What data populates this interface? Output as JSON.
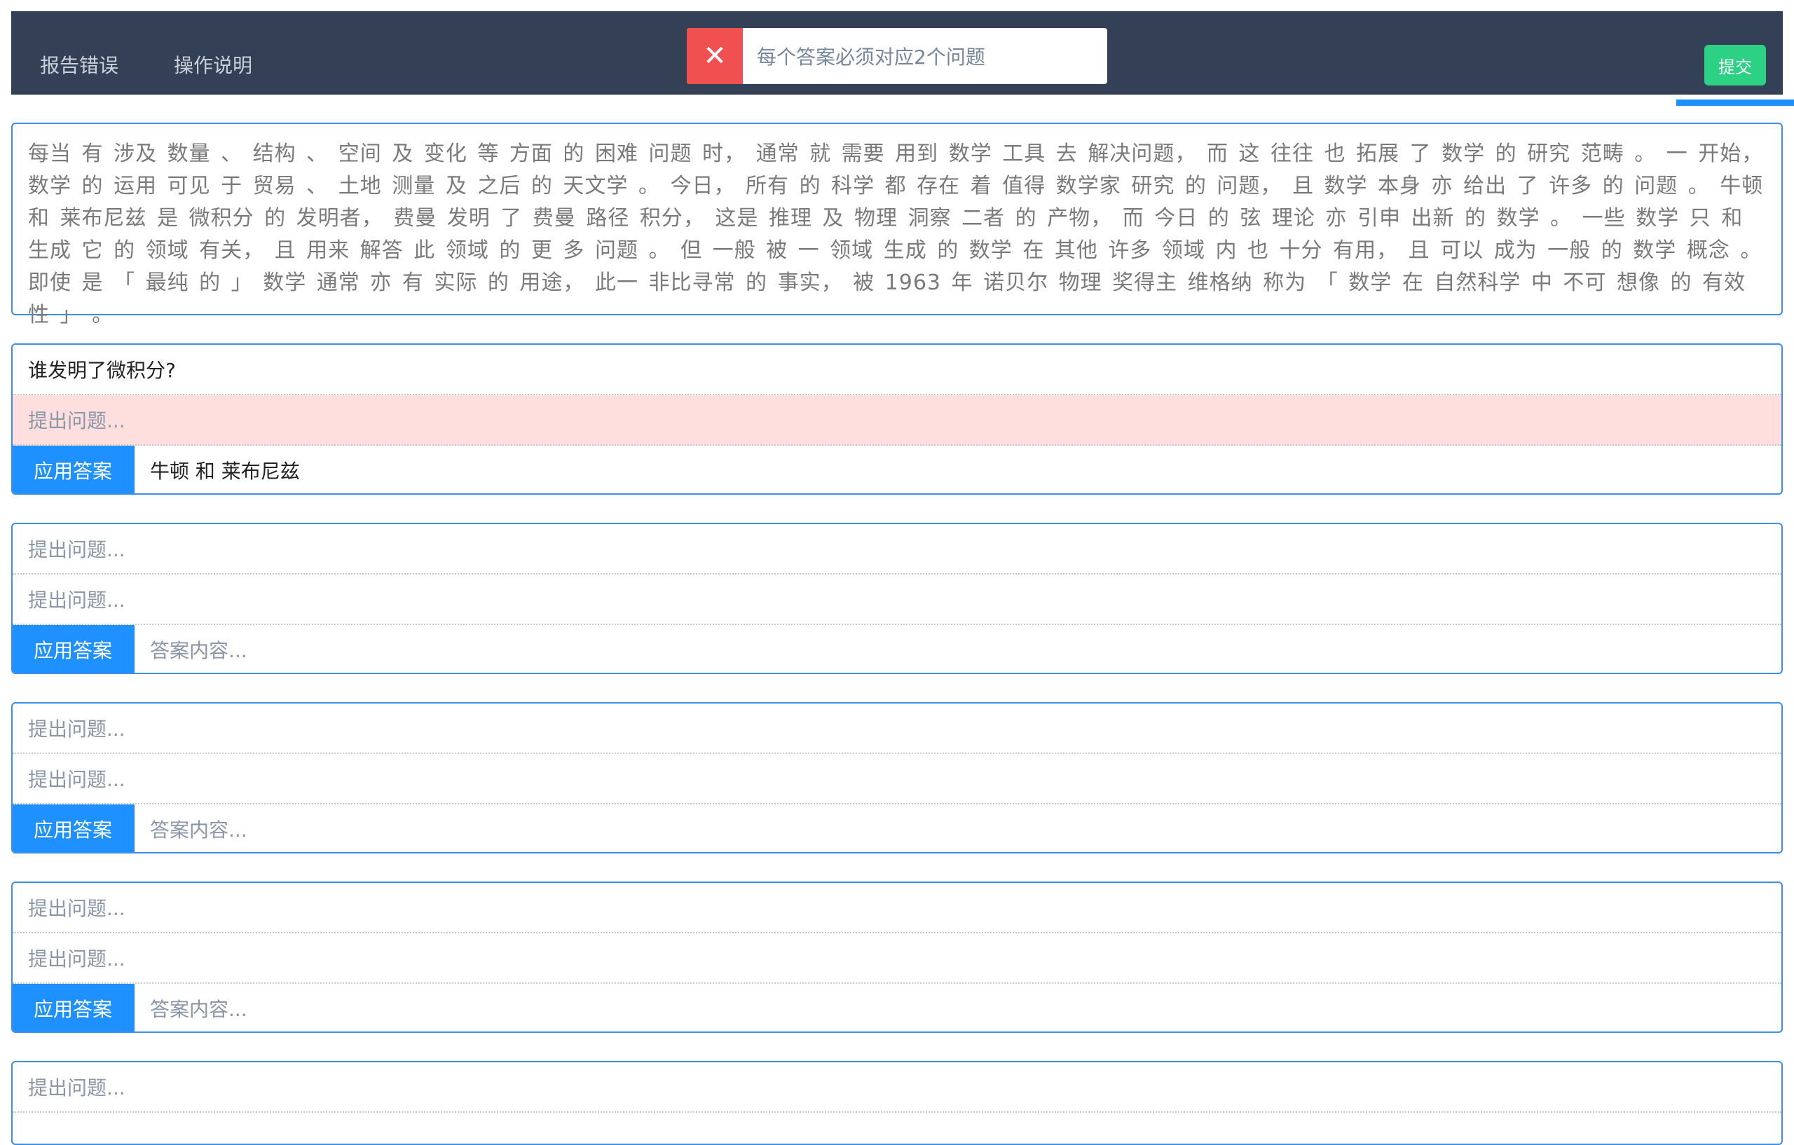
{
  "nav": {
    "report_label": "报告错误",
    "help_label": "操作说明",
    "submit_label": "提交"
  },
  "toast": {
    "icon": "close-icon",
    "message": "每个答案必须对应2个问题"
  },
  "passage": "每当 有 涉及 数量 、 结构 、 空间 及 变化 等 方面 的 困难 问题 时， 通常 就 需要 用到 数学 工具 去 解决问题， 而 这 往往 也 拓展 了 数学 的 研究 范畴 。 一 开始， 数学 的 运用 可见 于 贸易 、 土地 测量 及 之后 的 天文学 。 今日， 所有 的 科学 都 存在 着 值得 数学家 研究 的 问题， 且 数学 本身 亦 给出 了 许多 的 问题 。 牛顿 和 莱布尼兹 是 微积分 的 发明者， 费曼 发明 了 费曼 路径 积分， 这是 推理 及 物理 洞察 二者 的 产物， 而 今日 的 弦 理论 亦 引申 出新 的 数学 。 一些 数学 只 和 生成 它 的 领域 有关， 且 用来 解答 此 领域 的 更 多 问题 。 但 一般 被 一 领域 生成 的 数学 在 其他 许多 领域 内 也 十分 有用， 且 可以 成为 一般 的 数学 概念 。 即使 是 「 最纯 的 」 数学 通常 亦 有 实际 的 用途， 此一 非比寻常 的 事实， 被 1963 年 诺贝尔 物理 奖得主 维格纳 称为 「 数学 在 自然科学 中 不可 想像 的 有效性 」 。",
  "placeholders": {
    "question": "提出问题...",
    "answer": "答案内容..."
  },
  "apply_label": "应用答案",
  "qa_groups": [
    {
      "q1": "谁发明了微积分?",
      "q2": "提出问题...",
      "answer": "牛顿 和 莱布尼兹"
    },
    {
      "q1": "提出问题...",
      "q2": "提出问题...",
      "answer": "答案内容..."
    },
    {
      "q1": "提出问题...",
      "q2": "提出问题...",
      "answer": "答案内容..."
    },
    {
      "q1": "提出问题...",
      "q2": "提出问题...",
      "answer": "答案内容..."
    },
    {
      "q1": "提出问题..."
    }
  ],
  "colors": {
    "navbar": "#344055",
    "accent_blue": "#1e90ff",
    "submit_green": "#2cd183",
    "error_red": "#f05050",
    "error_row_bg": "#ffdede"
  }
}
